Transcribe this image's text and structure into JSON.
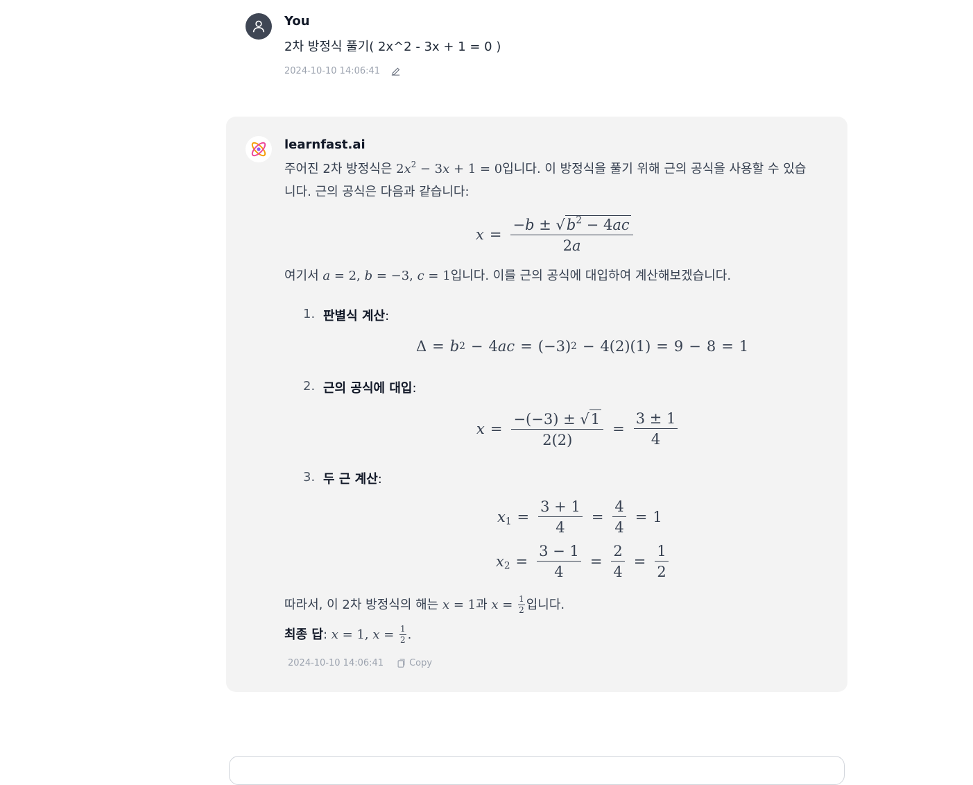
{
  "user": {
    "name": "You",
    "message": "2차 방정식 풀기( 2x^2 - 3x + 1 = 0 )",
    "timestamp": "2024-10-10 14:06:41",
    "avatar_icon": "user-icon",
    "edit_icon": "pencil-icon"
  },
  "assistant": {
    "name": "learnfast.ai",
    "logo_icon": "atom-logo-icon",
    "intro_a": "주어진 2차 방정식은 ",
    "intro_b": "입니다. 이 방정식을 풀기 위해 근의 공식을 사용할 수 있습니다. 근의 공식은 다음과 같습니다:",
    "where_a": "여기서 ",
    "where_b": "입니다. 이를 근의 공식에 대입하여 계산해보겠습니다.",
    "steps": [
      {
        "number": "1.",
        "title": "판별식 계산",
        "suffix": ":"
      },
      {
        "number": "2.",
        "title": "근의 공식에 대입",
        "suffix": ":"
      },
      {
        "number": "3.",
        "title": "두 근 계산",
        "suffix": ":"
      }
    ],
    "conclusion_a": "따라서, 이 2차 방정식의 해는 ",
    "conclusion_mid": "과 ",
    "conclusion_b": "입니다.",
    "final_label": "최종 답",
    "final_sep": ":",
    "timestamp": "2024-10-10 14:06:41",
    "copy_label": "Copy",
    "copy_icon": "clipboard-icon"
  },
  "colors": {
    "card_bg": "#f3f3f3",
    "avatar_bg": "#3f4654",
    "meta_text": "#9ca3af"
  }
}
